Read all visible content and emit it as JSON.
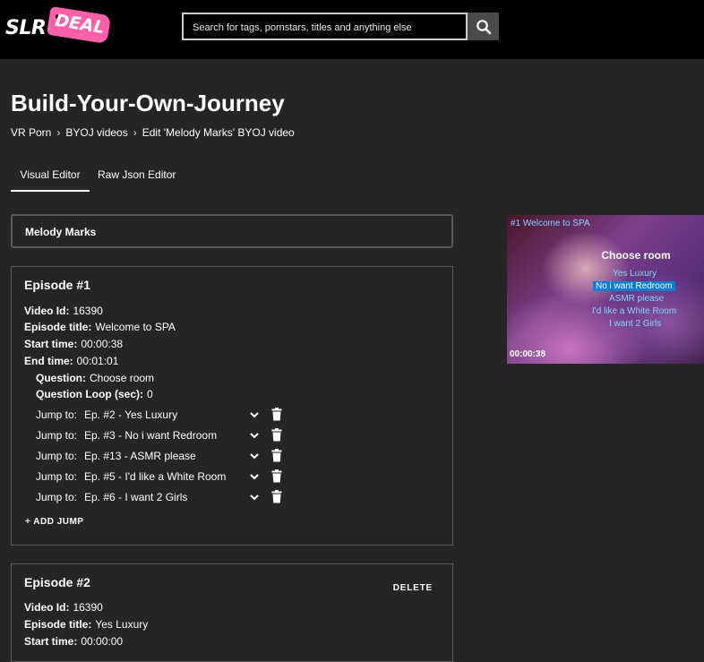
{
  "header": {
    "logo_slr": "SLR",
    "logo_deal": "DEAL",
    "search_placeholder": "Search for tags, pornstars, titles and anything else"
  },
  "page_title": "Build-Your-Own-Journey",
  "breadcrumb": [
    "VR Porn",
    "BYOJ videos",
    "Edit 'Melody Marks' BYOJ video"
  ],
  "breadcrumb_sep": "›",
  "tabs": [
    {
      "label": "Visual Editor",
      "active": true
    },
    {
      "label": "Raw Json Editor",
      "active": false
    }
  ],
  "performer": "Melody Marks",
  "episodes": [
    {
      "title": "Episode #1",
      "video_id_label": "Video Id:",
      "video_id": "16390",
      "episode_title_label": "Episode title:",
      "episode_title": "Welcome to SPA",
      "start_time_label": "Start time:",
      "start_time": "00:00:38",
      "end_time_label": "End time:",
      "end_time": "00:01:01",
      "question_label": "Question:",
      "question": "Choose room",
      "question_loop_label": "Question Loop (sec):",
      "question_loop": "0",
      "jump_label": "Jump to:",
      "jumps": [
        "Ep. #2 - Yes Luxury",
        "Ep. #3 - No i want Redroom",
        "Ep. #13 - ASMR please",
        "Ep. #5 - I'd like a White Room",
        "Ep. #6 - I want 2 Girls"
      ],
      "add_jump": "+ ADD JUMP"
    },
    {
      "title": "Episode #2",
      "delete_label": "DELETE",
      "video_id_label": "Video Id:",
      "video_id": "16390",
      "episode_title_label": "Episode title:",
      "episode_title": "Yes Luxury",
      "start_time_label": "Start time:",
      "start_time": "00:00:00"
    }
  ],
  "preview": {
    "title": "#1 Welcome to SPA",
    "question": "Choose room",
    "options": [
      "Yes Luxury",
      "No i want Redroom",
      "ASMR please",
      "I'd like a White Room",
      "I want 2 Girls"
    ],
    "selected_index": 1,
    "time": "00:00:38"
  },
  "colors": {
    "background": "#252525",
    "header": "#000000",
    "logo_tag": "#ff5fa8",
    "preview_text": "#7fd6ff",
    "preview_selected": "#0a7dd6"
  }
}
